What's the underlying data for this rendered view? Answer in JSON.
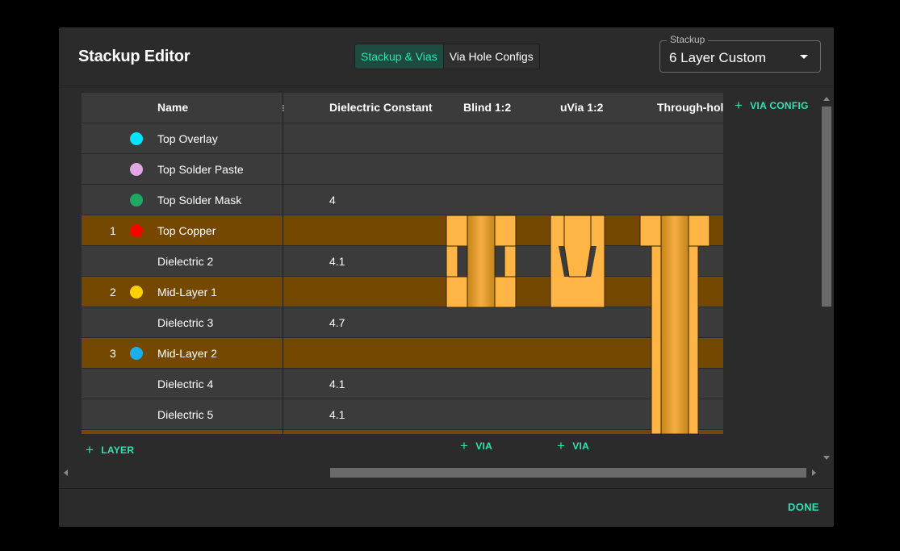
{
  "dialog": {
    "title": "Stackup Editor",
    "tabs": [
      {
        "label": "Stackup & Vias",
        "active": true
      },
      {
        "label": "Via Hole Configs",
        "active": false
      }
    ],
    "stackup_select": {
      "label": "Stackup",
      "value": "6 Layer Custom"
    }
  },
  "table": {
    "headers": {
      "name": "Name",
      "dielectric_constant": "Dielectric Constant",
      "col_blind": "Blind 1:2",
      "col_uvia": "uVia 1:2",
      "col_through": "Through-hole"
    },
    "rows": [
      {
        "num": "",
        "color": "#00e5ff",
        "name": "Top Overlay",
        "dk": "",
        "type": "dark"
      },
      {
        "num": "",
        "color": "#e3a5e3",
        "name": "Top Solder Paste",
        "dk": "",
        "type": "dark"
      },
      {
        "num": "",
        "color": "#1fa862",
        "name": "Top Solder Mask",
        "dk": "4",
        "type": "dark"
      },
      {
        "num": "1",
        "color": "#ff0000",
        "name": "Top Copper",
        "dk": "",
        "type": "copper"
      },
      {
        "num": "",
        "color": "",
        "name": "Dielectric 2",
        "dk": "4.1",
        "type": "dark"
      },
      {
        "num": "2",
        "color": "#ffd000",
        "name": "Mid-Layer 1",
        "dk": "",
        "type": "copper"
      },
      {
        "num": "",
        "color": "",
        "name": "Dielectric 3",
        "dk": "4.7",
        "type": "dark"
      },
      {
        "num": "3",
        "color": "#1ab0f0",
        "name": "Mid-Layer 2",
        "dk": "",
        "type": "copper"
      },
      {
        "num": "",
        "color": "",
        "name": "Dielectric 4",
        "dk": "4.1",
        "type": "dark"
      },
      {
        "num": "",
        "color": "",
        "name": "Dielectric 5",
        "dk": "4.1",
        "type": "dark"
      }
    ]
  },
  "actions": {
    "add_layer": "LAYER",
    "add_via": "VIA",
    "add_via_config": "VIA CONFIG",
    "done": "DONE"
  },
  "colors": {
    "accent": "#2ee3b1",
    "copper_row": "#744800",
    "via_fill": "#ffb446"
  }
}
